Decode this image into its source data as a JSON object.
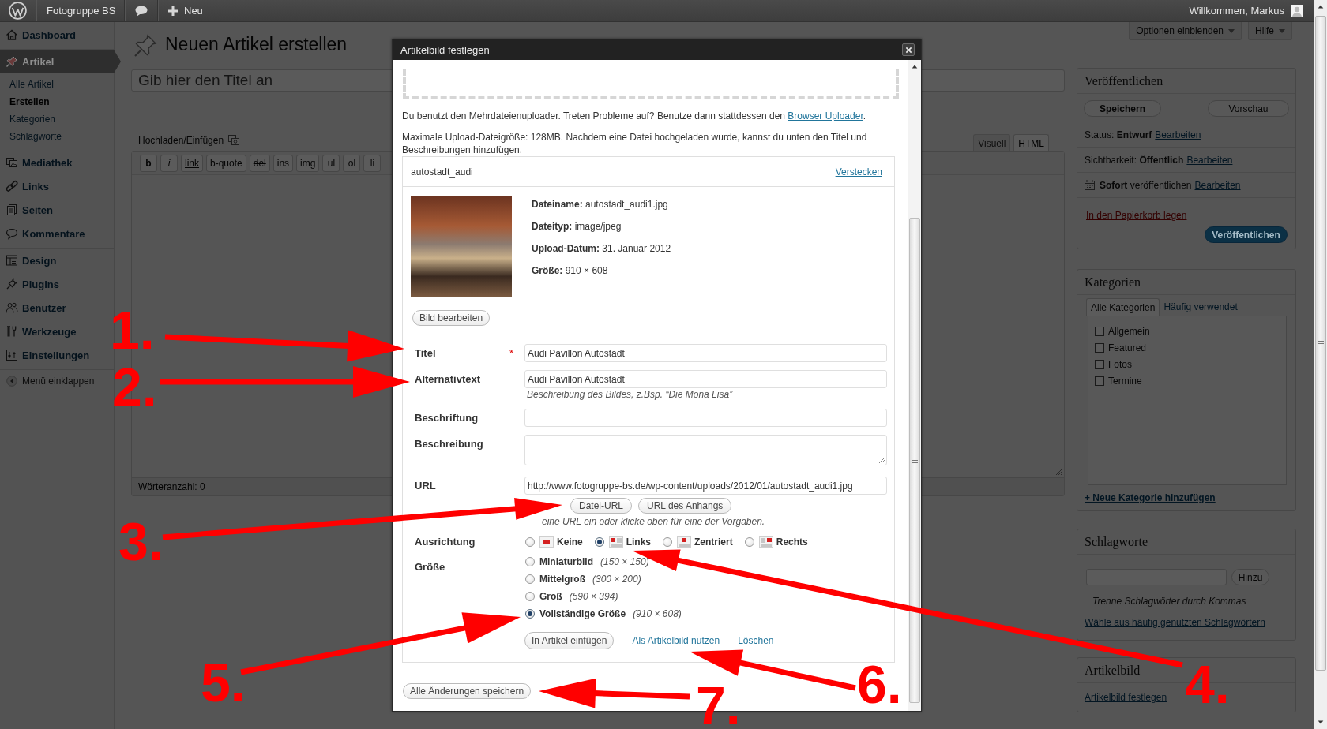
{
  "admin_bar": {
    "site_name": "Fotogruppe BS",
    "new_label": "Neu",
    "greeting": "Willkommen, Markus"
  },
  "sidebar": {
    "groups": [
      {
        "items": [
          {
            "label": "Dashboard",
            "selected": false
          }
        ]
      },
      {
        "items": [
          {
            "label": "Artikel",
            "selected": true,
            "children": [
              {
                "label": "Alle Artikel",
                "selected": false
              },
              {
                "label": "Erstellen",
                "selected": true
              },
              {
                "label": "Kategorien",
                "selected": false
              },
              {
                "label": "Schlagworte",
                "selected": false
              }
            ]
          },
          {
            "label": "Mediathek",
            "selected": false
          },
          {
            "label": "Links",
            "selected": false
          },
          {
            "label": "Seiten",
            "selected": false
          },
          {
            "label": "Kommentare",
            "selected": false
          }
        ]
      },
      {
        "items": [
          {
            "label": "Design",
            "selected": false
          },
          {
            "label": "Plugins",
            "selected": false
          },
          {
            "label": "Benutzer",
            "selected": false
          },
          {
            "label": "Werkzeuge",
            "selected": false
          },
          {
            "label": "Einstellungen",
            "selected": false
          }
        ]
      }
    ],
    "collapse_label": "Menü einklappen"
  },
  "screen_options": [
    {
      "label": "Optionen einblenden"
    },
    {
      "label": "Hilfe"
    }
  ],
  "page_title": "Neuen Artikel erstellen",
  "title_field": {
    "placeholder": "Gib hier den Titel an"
  },
  "editor": {
    "upload_label": "Hochladen/Einfügen",
    "tabs": [
      {
        "label": "Visuell",
        "selected": false
      },
      {
        "label": "HTML",
        "selected": true
      }
    ],
    "quicktags": [
      {
        "label": "b",
        "kind": "bold"
      },
      {
        "label": "i",
        "kind": "italic"
      },
      {
        "label": "link",
        "kind": "underline"
      },
      {
        "label": "b-quote",
        "kind": "plain"
      },
      {
        "label": "del",
        "kind": "strike"
      },
      {
        "label": "ins",
        "kind": "plain"
      },
      {
        "label": "img",
        "kind": "plain"
      },
      {
        "label": "ul",
        "kind": "plain"
      },
      {
        "label": "ol",
        "kind": "plain"
      },
      {
        "label": "li",
        "kind": "plain"
      }
    ],
    "word_count": "Wörteranzahl: 0"
  },
  "publish_box": {
    "title": "Veröffentlichen",
    "save_button": "Speichern",
    "preview_button": "Vorschau",
    "rows": [
      {
        "kind": "plain",
        "text": "Status: **Entwurf**",
        "link": "Bearbeiten"
      },
      {
        "kind": "plain",
        "text": "Sichtbarkeit: **Öffentlich**",
        "link": "Bearbeiten"
      },
      {
        "kind": "schedule",
        "text": "**Sofort** veröffentlichen",
        "link": "Bearbeiten"
      }
    ],
    "trash_link": "In den Papierkorb legen",
    "publish_button": "Veröffentlichen"
  },
  "categories_box": {
    "title": "Kategorien",
    "tabs": [
      {
        "label": "Alle Kategorien",
        "selected": true
      },
      {
        "label": "Häufig verwendet",
        "selected": false
      }
    ],
    "items": [
      {
        "label": "Allgemein",
        "checked": false
      },
      {
        "label": "Featured",
        "checked": false
      },
      {
        "label": "Fotos",
        "checked": false
      },
      {
        "label": "Termine",
        "checked": false
      }
    ],
    "add_link": "+ Neue Kategorie hinzufügen"
  },
  "tags_box": {
    "title": "Schlagworte",
    "add_button": "Hinzu",
    "hint": "Trenne Schlagwörter durch Kommas",
    "choose_link": "Wähle aus häufig genutzten Schlagwörtern"
  },
  "featured_box": {
    "title": "Artikelbild",
    "set_link": "Artikelbild festlegen"
  },
  "modal": {
    "title": "Artikelbild festlegen",
    "uploader_note": "Du benutzt den Mehrdateienuploader. Treten Probleme auf? Benutze dann stattdessen den ",
    "uploader_link": "Browser Uploader",
    "uploader_note_end": ".",
    "limit_note": "Maximale Upload-Dateigröße: 128MB. Nachdem eine Datei hochgeladen wurde, kannst du unten den Titel und Beschreibungen hinzufügen.",
    "item": {
      "name": "autostadt_audi",
      "toggle_link": "Verstecken",
      "details": [
        "**Dateiname:** autostadt_audi1.jpg",
        "**Dateityp:** image/jpeg",
        "**Upload-Datum:** 31. Januar 2012",
        "**Größe:** 910 × 608"
      ]
    },
    "edit_button": "Bild bearbeiten",
    "fields": [
      {
        "kind": "text",
        "label": "Titel",
        "required_mark": "*",
        "value": "Audi Pavillon Autostadt"
      },
      {
        "kind": "text",
        "label": "Alternativtext",
        "value": "Audi Pavillon Autostadt",
        "help": "Beschreibung des Bildes, z.Bsp. “Die Mona Lisa”"
      },
      {
        "kind": "text",
        "label": "Beschriftung"
      },
      {
        "kind": "textarea",
        "label": "Beschreibung"
      },
      {
        "kind": "url",
        "label": "URL",
        "value": "http://www.fotogruppe-bs.de/wp-content/uploads/2012/01/autostadt_audi1.jpg",
        "buttons": [
          "Datei-URL",
          "URL des Anhangs"
        ],
        "help": "eine URL ein oder klicke oben für eine der Vorgaben."
      },
      {
        "kind": "radio-row",
        "label": "Ausrichtung",
        "options": [
          {
            "label": "Keine",
            "selected": false
          },
          {
            "label": "Links",
            "selected": true
          },
          {
            "label": "Zentriert",
            "selected": false
          },
          {
            "label": "Rechts",
            "selected": false
          }
        ]
      },
      {
        "kind": "radio-list",
        "label": "Größe",
        "options": [
          {
            "label": "Miniaturbild",
            "dimensions": "(150 × 150)",
            "selected": false
          },
          {
            "label": "Mittelgroß",
            "dimensions": "(300 × 200)",
            "selected": false
          },
          {
            "label": "Groß",
            "dimensions": "(590 × 394)",
            "selected": false
          },
          {
            "label": "Vollständige Größe",
            "dimensions": "(910 × 608)",
            "selected": true
          }
        ]
      }
    ],
    "insert_button": "In Artikel einfügen",
    "links": [
      "Als Artikelbild nutzen",
      "Löschen"
    ],
    "save_all_button": "Alle Änderungen speichern"
  },
  "annotations": [
    {
      "label": "1."
    },
    {
      "label": "2."
    },
    {
      "label": "3."
    },
    {
      "label": "5."
    },
    {
      "label": "7."
    },
    {
      "label": "6."
    },
    {
      "label": "4."
    }
  ]
}
